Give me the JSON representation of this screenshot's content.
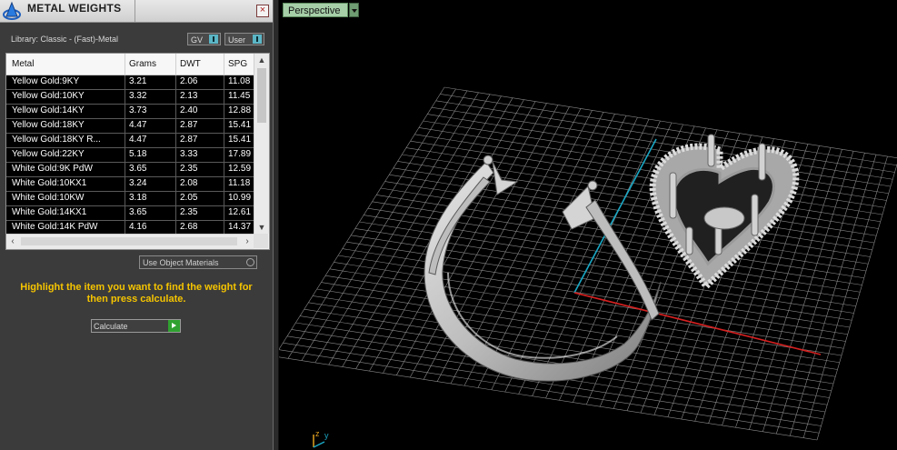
{
  "panel": {
    "title": "METAL WEIGHTS",
    "close_label": "×",
    "library_label": "Library: Classic - (Fast)-Metal",
    "gv_label": "GV",
    "user_label": "User",
    "columns": [
      "Metal",
      "Grams",
      "DWT",
      "SPG"
    ],
    "rows": [
      [
        "Yellow Gold:9KY",
        "3.21",
        "2.06",
        "11.08"
      ],
      [
        "Yellow Gold:10KY",
        "3.32",
        "2.13",
        "11.45"
      ],
      [
        "Yellow Gold:14KY",
        "3.73",
        "2.40",
        "12.88"
      ],
      [
        "Yellow Gold:18KY",
        "4.47",
        "2.87",
        "15.41"
      ],
      [
        "Yellow Gold:18KY R...",
        "4.47",
        "2.87",
        "15.41"
      ],
      [
        "Yellow Gold:22KY",
        "5.18",
        "3.33",
        "17.89"
      ],
      [
        "White Gold:9K PdW",
        "3.65",
        "2.35",
        "12.59"
      ],
      [
        "White Gold:10KX1",
        "3.24",
        "2.08",
        "11.18"
      ],
      [
        "White Gold:10KW",
        "3.18",
        "2.05",
        "10.99"
      ],
      [
        "White Gold:14KX1",
        "3.65",
        "2.35",
        "12.61"
      ],
      [
        "White Gold:14K PdW",
        "4.16",
        "2.68",
        "14.37"
      ]
    ],
    "use_object_materials": "Use Object Materials",
    "instruction": "Highlight the item you want to find the weight for then press calculate.",
    "calculate_label": "Calculate"
  },
  "viewport": {
    "view_label": "Perspective",
    "axis_y_color": "#1aa7c4",
    "axis_x_color": "#d42020",
    "grid_color": "#8a8a8a",
    "gizmo_z": "z",
    "gizmo_y": "y"
  }
}
